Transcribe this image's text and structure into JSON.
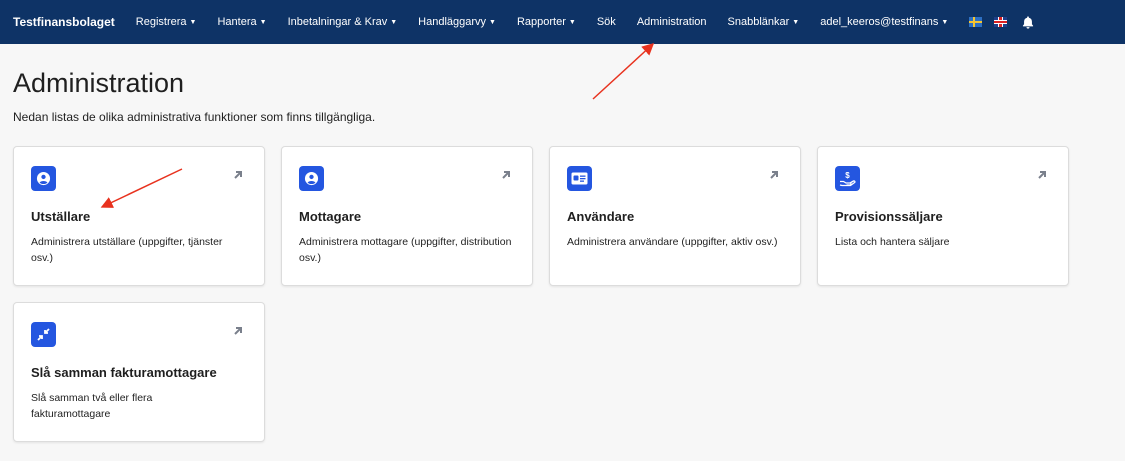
{
  "nav": {
    "brand": "Testfinansbolaget",
    "items": [
      {
        "label": "Registrera",
        "dropdown": true
      },
      {
        "label": "Hantera",
        "dropdown": true
      },
      {
        "label": "Inbetalningar & Krav",
        "dropdown": true
      },
      {
        "label": "Handläggarvy",
        "dropdown": true
      },
      {
        "label": "Rapporter",
        "dropdown": true
      },
      {
        "label": "Sök",
        "dropdown": false
      },
      {
        "label": "Administration",
        "dropdown": false
      },
      {
        "label": "Snabblänkar",
        "dropdown": true
      },
      {
        "label": "adel_keeros@testfinans",
        "dropdown": true
      }
    ],
    "caret": "▼",
    "colors": {
      "navbar": "#0e3366"
    }
  },
  "page": {
    "title": "Administration",
    "description": "Nedan listas de olika administrativa funktioner som finns tillgängliga."
  },
  "cards": [
    {
      "title": "Utställare",
      "description": "Administrera utställare (uppgifter, tjänster osv.)",
      "icon": "user-circle-icon"
    },
    {
      "title": "Mottagare",
      "description": "Administrera mottagare (uppgifter, distribution osv.)",
      "icon": "user-circle-icon"
    },
    {
      "title": "Användare",
      "description": "Administrera användare (uppgifter, aktiv osv.)",
      "icon": "id-card-icon"
    },
    {
      "title": "Provisionssäljare",
      "description": "Lista och hantera säljare",
      "icon": "hand-dollar-icon"
    },
    {
      "title": "Slå samman fakturamottagare",
      "description": "Slå samman två eller flera fakturamottagare",
      "icon": "merge-arrows-icon"
    }
  ],
  "colors": {
    "accent": "#2456e0",
    "annotation": "#e8321e"
  }
}
